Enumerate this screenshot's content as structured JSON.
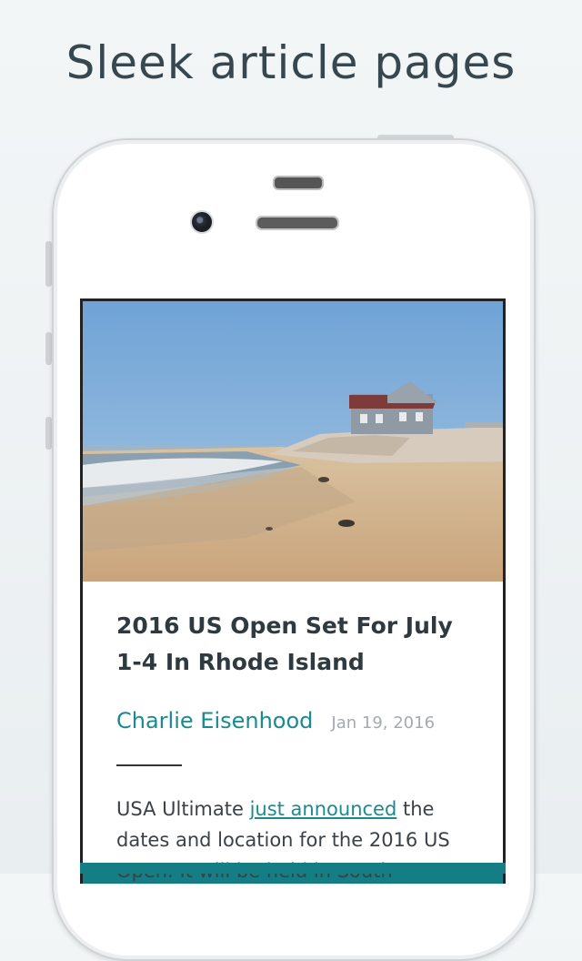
{
  "promo": {
    "headline": "Sleek article pages"
  },
  "article": {
    "title": "2016 US Open Set For July 1-4 In Rhode Island",
    "author": "Charlie Eisenhood",
    "date": "Jan 19, 2016",
    "body_before_link": "USA Ultimate ",
    "link_text": "just announced",
    "body_after_link": " the dates and location for the 2016 US Open. It will be held in South"
  },
  "colors": {
    "accent": "#1a8a91",
    "bottom_bar": "#157e85",
    "title": "#2f3a40"
  }
}
